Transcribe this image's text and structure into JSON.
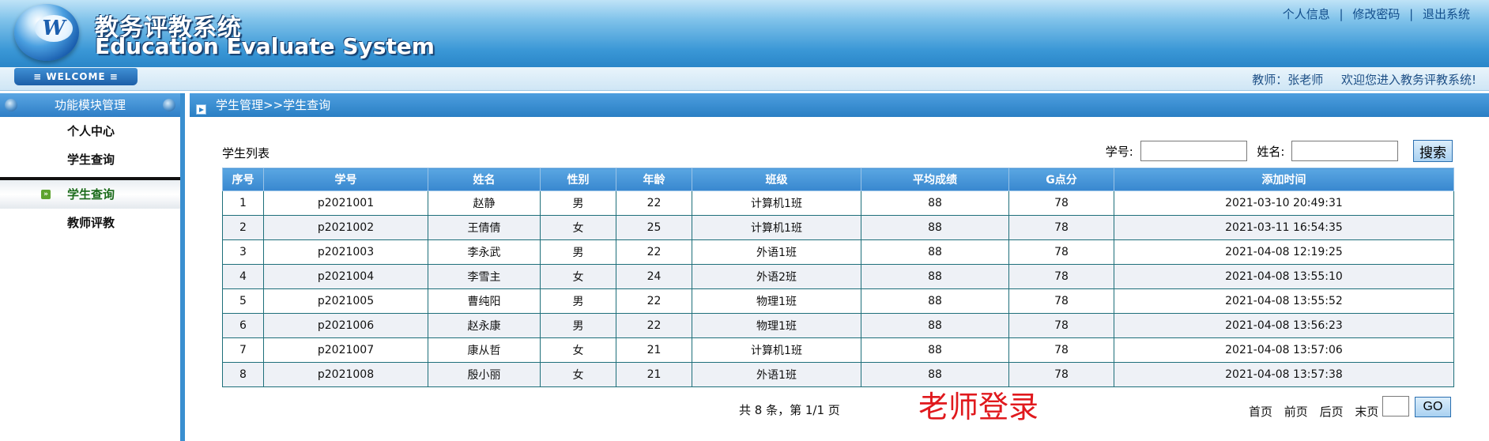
{
  "header": {
    "logo_letter": "W",
    "title_cn": "教务评教系统",
    "title_en": "Education Evaluate System",
    "links": {
      "profile": "个人信息",
      "password": "修改密码",
      "logout": "退出系统",
      "sep": "|"
    }
  },
  "welcome": {
    "tab_label": "≡ WELCOME ≡",
    "user": "教师：张老师",
    "message": "欢迎您进入教务评教系统!"
  },
  "sidebar": {
    "title": "功能模块管理",
    "items": [
      {
        "label": "个人中心"
      },
      {
        "label": "学生查询"
      },
      {
        "label": "学生查询"
      },
      {
        "label": "教师评教"
      }
    ],
    "bullet": "»"
  },
  "breadcrumb": "学生管理>>学生查询",
  "list_title": "学生列表",
  "search": {
    "id_label": "学号:",
    "name_label": "姓名:",
    "id_value": "",
    "name_value": "",
    "button": "搜索"
  },
  "table": {
    "columns": [
      "序号",
      "学号",
      "姓名",
      "性别",
      "年龄",
      "班级",
      "平均成绩",
      "G点分",
      "添加时间"
    ],
    "rows": [
      [
        "1",
        "p2021001",
        "赵静",
        "男",
        "22",
        "计算机1班",
        "88",
        "78",
        "2021-03-10 20:49:31"
      ],
      [
        "2",
        "p2021002",
        "王倩倩",
        "女",
        "25",
        "计算机1班",
        "88",
        "78",
        "2021-03-11 16:54:35"
      ],
      [
        "3",
        "p2021003",
        "李永武",
        "男",
        "22",
        "外语1班",
        "88",
        "78",
        "2021-04-08 12:19:25"
      ],
      [
        "4",
        "p2021004",
        "李雪主",
        "女",
        "24",
        "外语2班",
        "88",
        "78",
        "2021-04-08 13:55:10"
      ],
      [
        "5",
        "p2021005",
        "曹纯阳",
        "男",
        "22",
        "物理1班",
        "88",
        "78",
        "2021-04-08 13:55:52"
      ],
      [
        "6",
        "p2021006",
        "赵永康",
        "男",
        "22",
        "物理1班",
        "88",
        "78",
        "2021-04-08 13:56:23"
      ],
      [
        "7",
        "p2021007",
        "康从哲",
        "女",
        "21",
        "计算机1班",
        "88",
        "78",
        "2021-04-08 13:57:06"
      ],
      [
        "8",
        "p2021008",
        "殷小丽",
        "女",
        "21",
        "外语1班",
        "88",
        "78",
        "2021-04-08 13:57:38"
      ]
    ]
  },
  "pager": {
    "info": "共 8 条，第 1/1 页",
    "first": "首页",
    "prev": "前页",
    "next": "后页",
    "last": "末页",
    "goto_value": "",
    "go": "GO"
  },
  "watermark": "老师登录"
}
